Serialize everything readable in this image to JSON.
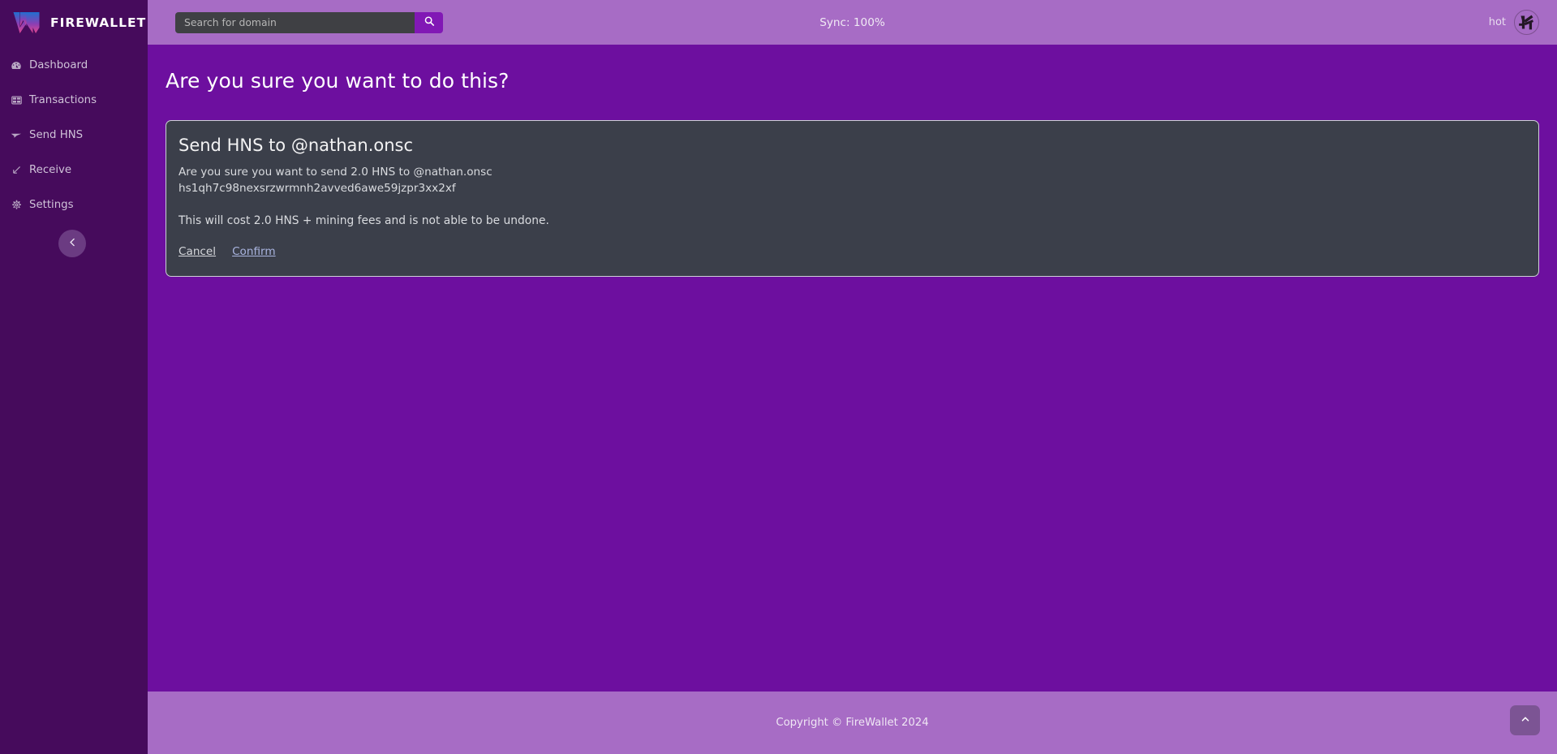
{
  "brand": {
    "name": "FIREWALLET",
    "logo_icon": "firewallet-w-logo",
    "logo_gradient_start": "#1f6fd0",
    "logo_gradient_end": "#e2468f"
  },
  "sidebar": {
    "items": [
      {
        "label": "Dashboard",
        "icon": "speedometer-icon"
      },
      {
        "label": "Transactions",
        "icon": "table-grid-icon"
      },
      {
        "label": "Send HNS",
        "icon": "paper-plane-icon"
      },
      {
        "label": "Receive",
        "icon": "arrow-down-left-icon"
      },
      {
        "label": "Settings",
        "icon": "gear-icon"
      }
    ],
    "collapse_icon": "chevron-left-icon",
    "background_color": "#460b5c"
  },
  "header": {
    "search": {
      "value": "",
      "placeholder": "Search for domain",
      "button_icon": "search-icon",
      "button_color": "#8118b5"
    },
    "sync_status": "Sync: 100%",
    "wallet_name": "hot",
    "avatar_icon": "wallet-identicon-avatar",
    "background_color": "#a76cc5"
  },
  "main": {
    "page_title": "Are you sure you want to do this?",
    "background_color": "#6d0f9f",
    "card": {
      "title": "Send HNS to @nathan.onsc",
      "description_line_1": "Are you sure you want to send 2.0 HNS to @nathan.onsc",
      "address": "hs1qh7c98nexsrzwrmnh2avved6awe59jzpr3xx2xf",
      "cost_note": "This will cost 2.0 HNS + mining fees and is not able to be undone.",
      "cancel_label": "Cancel",
      "confirm_label": "Confirm",
      "background_color": "#3b3f4a",
      "border_color": "#cdd0d6"
    }
  },
  "footer": {
    "copyright": "Copyright © FireWallet 2024",
    "to_top_icon": "chevron-up-icon",
    "background_color": "#a76cc5"
  }
}
